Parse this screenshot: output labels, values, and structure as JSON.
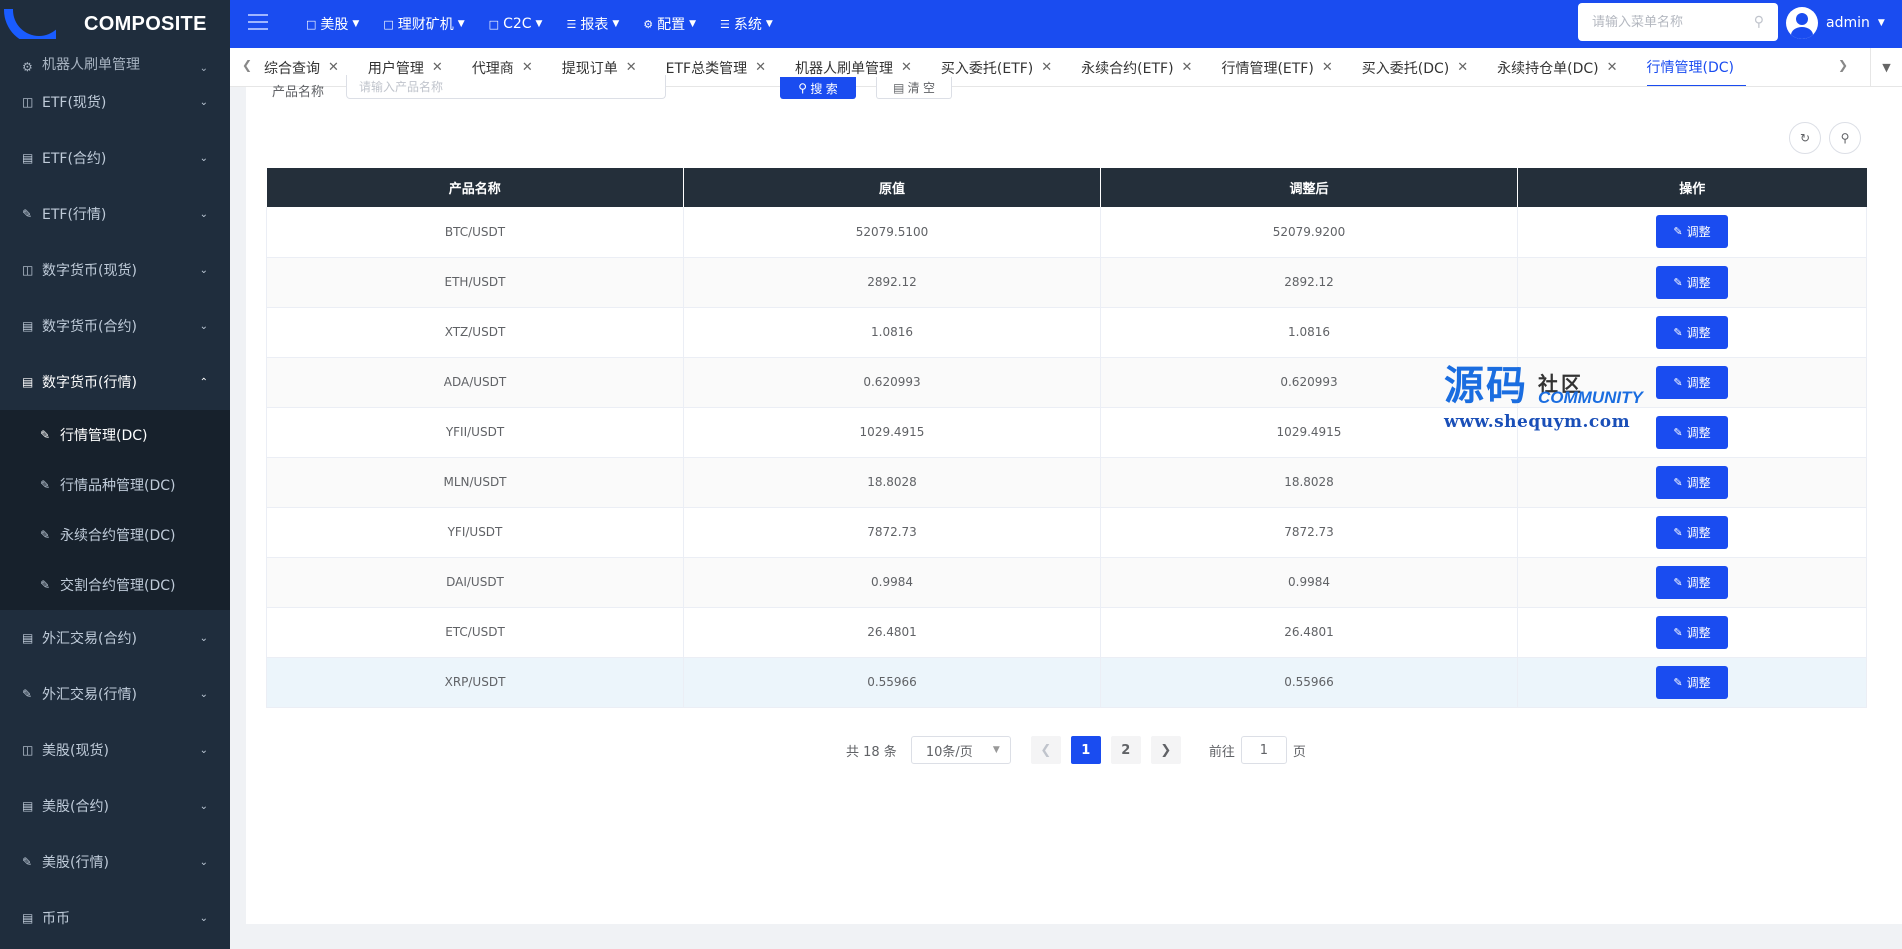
{
  "app": {
    "logo_text": "COMPOSITE"
  },
  "topnav": [
    {
      "label": "美股",
      "icon": "bar-chart-icon"
    },
    {
      "label": "理财矿机",
      "icon": "doc-icon"
    },
    {
      "label": "C2C",
      "icon": "doc-icon"
    },
    {
      "label": "报表",
      "icon": "list-icon"
    },
    {
      "label": "配置",
      "icon": "gear-icon"
    },
    {
      "label": "系统",
      "icon": "list-icon"
    }
  ],
  "menu_search": {
    "placeholder": "请输入菜单名称"
  },
  "user": {
    "name": "admin"
  },
  "sidebar": {
    "top_partial": "机器人刷单管理",
    "items": [
      {
        "label": "ETF(现货)"
      },
      {
        "label": "ETF(合约)"
      },
      {
        "label": "ETF(行情)"
      },
      {
        "label": "数字货币(现货)"
      },
      {
        "label": "数字货币(合约)"
      }
    ],
    "open_item": {
      "label": "数字货币(行情)"
    },
    "sub_items": [
      {
        "label": "行情管理(DC)"
      },
      {
        "label": "行情品种管理(DC)"
      },
      {
        "label": "永续合约管理(DC)"
      },
      {
        "label": "交割合约管理(DC)"
      }
    ],
    "items_after": [
      {
        "label": "外汇交易(合约)"
      },
      {
        "label": "外汇交易(行情)"
      },
      {
        "label": "美股(现货)"
      },
      {
        "label": "美股(合约)"
      },
      {
        "label": "美股(行情)"
      },
      {
        "label": "币币"
      }
    ]
  },
  "tabs": [
    {
      "label": "综合查询"
    },
    {
      "label": "用户管理"
    },
    {
      "label": "代理商"
    },
    {
      "label": "提现订单"
    },
    {
      "label": "ETF总类管理"
    },
    {
      "label": "机器人刷单管理"
    },
    {
      "label": "买入委托(ETF)"
    },
    {
      "label": "永续合约(ETF)"
    },
    {
      "label": "行情管理(ETF)"
    },
    {
      "label": "买入委托(DC)"
    },
    {
      "label": "永续持仓单(DC)"
    },
    {
      "label": "行情管理(DC)"
    }
  ],
  "filter": {
    "label": "产品名称",
    "placeholder": "请输入产品名称",
    "search_label": "搜 索",
    "clear_label": "清 空"
  },
  "table": {
    "headers": [
      "产品名称",
      "原值",
      "调整后",
      "操作"
    ],
    "action_label": "调整",
    "rows": [
      {
        "name": "BTC/USDT",
        "original": "52079.5100",
        "adjusted": "52079.9200"
      },
      {
        "name": "ETH/USDT",
        "original": "2892.12",
        "adjusted": "2892.12"
      },
      {
        "name": "XTZ/USDT",
        "original": "1.0816",
        "adjusted": "1.0816"
      },
      {
        "name": "ADA/USDT",
        "original": "0.620993",
        "adjusted": "0.620993"
      },
      {
        "name": "YFII/USDT",
        "original": "1029.4915",
        "adjusted": "1029.4915"
      },
      {
        "name": "MLN/USDT",
        "original": "18.8028",
        "adjusted": "18.8028"
      },
      {
        "name": "YFI/USDT",
        "original": "7872.73",
        "adjusted": "7872.73"
      },
      {
        "name": "DAI/USDT",
        "original": "0.9984",
        "adjusted": "0.9984"
      },
      {
        "name": "ETC/USDT",
        "original": "26.4801",
        "adjusted": "26.4801"
      },
      {
        "name": "XRP/USDT",
        "original": "0.55966",
        "adjusted": "0.55966"
      }
    ]
  },
  "pagination": {
    "total": "共 18 条",
    "page_size": "10条/页",
    "pages": [
      "1",
      "2"
    ],
    "current": "1",
    "goto_prefix": "前往",
    "goto_value": "1",
    "goto_suffix": "页"
  },
  "watermark": {
    "big": "源码",
    "cn": "社区",
    "en": "COMMUNITY",
    "url": "www.shequym.com"
  }
}
